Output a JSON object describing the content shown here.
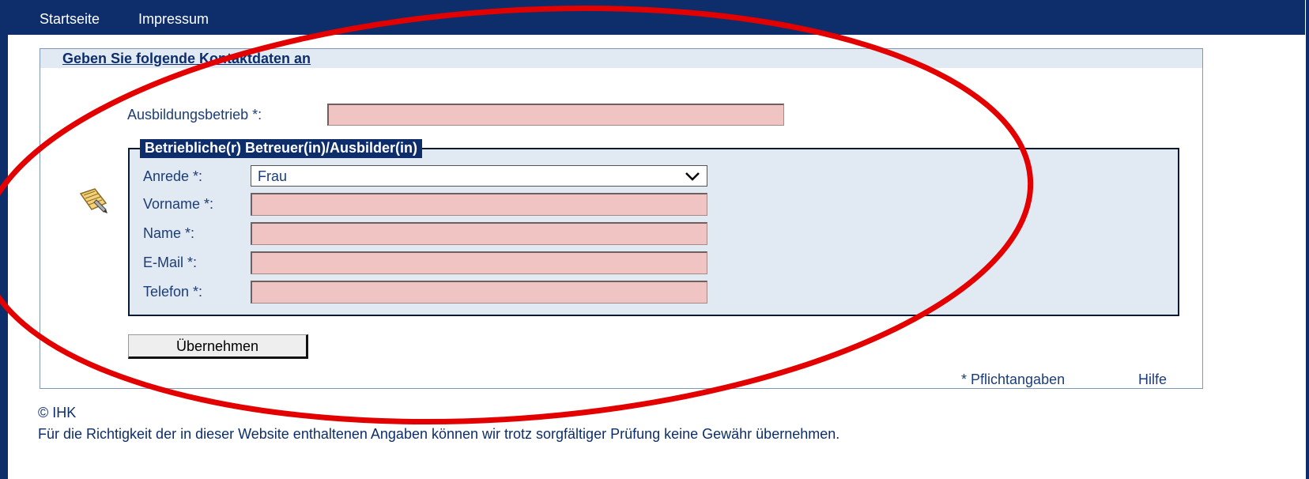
{
  "nav": {
    "items": [
      "Startseite",
      "Impressum"
    ]
  },
  "panel": {
    "title": "Geben Sie folgende Kontaktdaten an",
    "company_label": "Ausbildungsbetrieb *:",
    "company_value": ""
  },
  "group": {
    "legend": "Betriebliche(r) Betreuer(in)/Ausbilder(in)",
    "salutation_label": "Anrede *:",
    "salutation_value": "Frau",
    "firstname_label": "Vorname *:",
    "lastname_label": "Name *:",
    "email_label": "E-Mail *:",
    "phone_label": "Telefon *:"
  },
  "actions": {
    "submit_label": "Übernehmen"
  },
  "links": {
    "required_note": "* Pflichtangaben",
    "help": "Hilfe"
  },
  "footer": {
    "copyright": "© IHK",
    "disclaimer": "Für die Richtigkeit der in dieser Website enthaltenen Angaben können wir trotz sorgfältiger Prüfung keine Gewähr übernehmen."
  },
  "colors": {
    "navy": "#0d2e6b",
    "text": "#1c3d78",
    "required_field": "#f1c4c4",
    "panel_tint": "#e1e9f3",
    "annotation": "#e30000"
  },
  "icons": {
    "memo": "edit-note-icon",
    "dropdown": "chevron-down-icon"
  }
}
